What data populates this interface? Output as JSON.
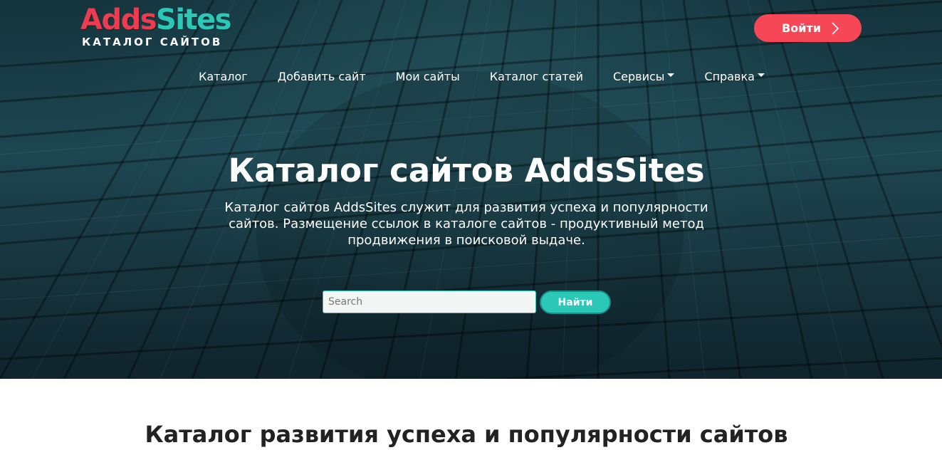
{
  "header": {
    "logo": {
      "adds": "Adds",
      "sites": "Sites",
      "subtitle": "КАТАЛОГ САЙТОВ"
    },
    "login_label": "Войти"
  },
  "nav": {
    "items": [
      {
        "label": "Каталог"
      },
      {
        "label": "Добавить сайт"
      },
      {
        "label": "Мои сайты"
      },
      {
        "label": "Каталог статей"
      },
      {
        "label": "Сервисы"
      },
      {
        "label": "Справка"
      }
    ]
  },
  "hero": {
    "title": "Каталог сайтов AddsSites",
    "description": "Каталог сайтов AddsSites служит для развития успеха и популярности сайтов. Размещение ссылок в каталоге сайтов - продуктивный метод продвижения в поисковой выдаче."
  },
  "search": {
    "placeholder": "Search",
    "button_label": "Найти"
  },
  "section": {
    "title": "Каталог развития успеха и популярности сайтов"
  },
  "colors": {
    "accent_red": "#f64757",
    "accent_teal": "#2bc8b8",
    "hero_bg": "#1d4651"
  },
  "icons": {
    "login": "chevron-right-icon",
    "dropdown": "caret-down-icon"
  }
}
